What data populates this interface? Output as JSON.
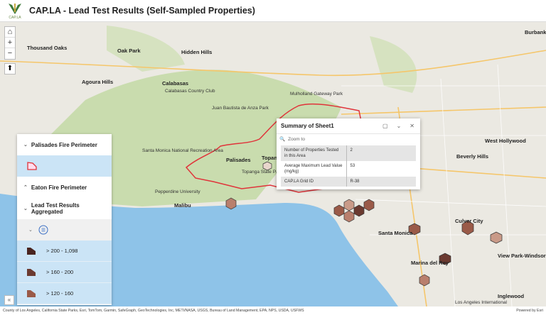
{
  "header": {
    "title": "CAP.LA - Lead Test Results (Self-Sampled Properties)",
    "logo_text": "CAP.LA"
  },
  "map_controls": {
    "home": "⌂",
    "zoom_in": "+",
    "zoom_out": "−",
    "compass": "⬆",
    "collapse": "«"
  },
  "map_labels": {
    "cities": [
      "Thousand Oaks",
      "Oak Park",
      "Hidden Hills",
      "Agoura Hills",
      "Calabasas",
      "Topanga",
      "Palisades",
      "Malibu",
      "Santa Monica",
      "Culver City",
      "Beverly Hills",
      "West Hollywood",
      "Marina del Rey",
      "View Park-Windsor Hills",
      "Inglewood",
      "Burbank"
    ],
    "minor": [
      "Calabasas Country Club",
      "Juan Bautista de Anza Park",
      "Santa Monica National Recreation Area",
      "Pepperdine University",
      "Mulholland Gateway Park",
      "Topanga State Park",
      "Los Angeles International"
    ]
  },
  "legend": {
    "layers": [
      {
        "name": "Palisades Fire Perimeter",
        "expanded": true
      },
      {
        "name": "Eaton Fire Perimeter",
        "expanded": false
      },
      {
        "name": "Lead Test Results Aggregated",
        "expanded": true
      }
    ],
    "classes": [
      {
        "label": "> 200 - 1,098",
        "color": "#4a2520"
      },
      {
        "label": "> 160 - 200",
        "color": "#6b3a30"
      },
      {
        "label": "> 120 - 160",
        "color": "#9a5a48"
      }
    ],
    "fire_color": "#e0333a"
  },
  "popup": {
    "title": "Summary of Sheet1",
    "zoom_to": "Zoom to",
    "rows": [
      {
        "field": "Number of Properties Tested in this Area",
        "value": "2"
      },
      {
        "field": "Average Maximum Lead Value (mg/kg)",
        "value": "53"
      },
      {
        "field": "CAP.LA Grid ID",
        "value": "R-38"
      }
    ]
  },
  "attribution": {
    "sources": "County of Los Angeles, California State Parks, Esri, TomTom, Garmin, SafeGraph, GeoTechnologies, Inc, METI/NASA, USGS, Bureau of Land Management, EPA, NPS, USDA, USFWS",
    "powered_by": "Powered by Esri"
  }
}
